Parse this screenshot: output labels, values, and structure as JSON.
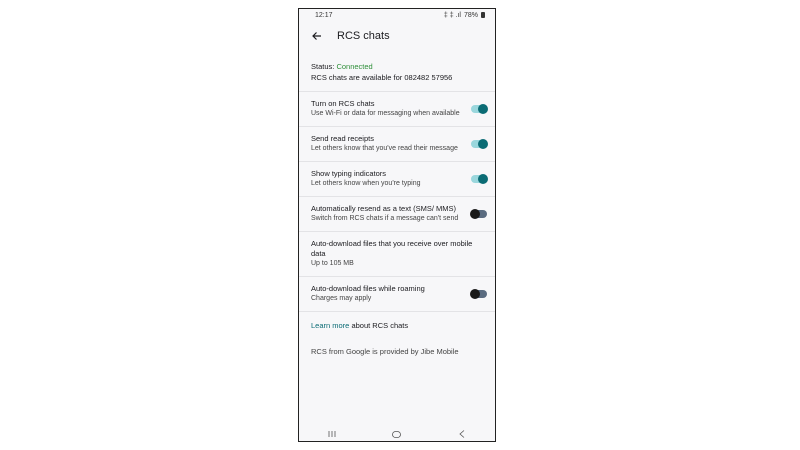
{
  "statusbar": {
    "time": "12:17",
    "signal": "‡ ‡ .ıl",
    "battery": "78%"
  },
  "appbar": {
    "title": "RCS chats"
  },
  "status": {
    "label": "Status: ",
    "value": "Connected",
    "detail": "RCS chats are available for 082482 57956"
  },
  "settings": [
    {
      "label": "Turn on RCS chats",
      "sub": "Use Wi-Fi or data for messaging when available",
      "toggle": "on"
    },
    {
      "label": "Send read receipts",
      "sub": "Let others know that you've read their message",
      "toggle": "on"
    },
    {
      "label": "Show typing indicators",
      "sub": "Let others know when you're typing",
      "toggle": "on"
    },
    {
      "label": "Automatically resend as a text (SMS/ MMS)",
      "sub": "Switch from RCS chats if a message can't send",
      "toggle": "off"
    },
    {
      "label": "Auto-download files that you receive over mobile data",
      "sub": "Up to 105 MB",
      "toggle": "none"
    },
    {
      "label": "Auto-download files while roaming",
      "sub": "Charges may apply",
      "toggle": "off"
    }
  ],
  "learn": {
    "link": "Learn more",
    "rest": " about RCS chats"
  },
  "footer": "RCS from Google is provided by Jibe Mobile",
  "colors": {
    "accent": "#0a6b74",
    "connected": "#2f8f3a"
  }
}
